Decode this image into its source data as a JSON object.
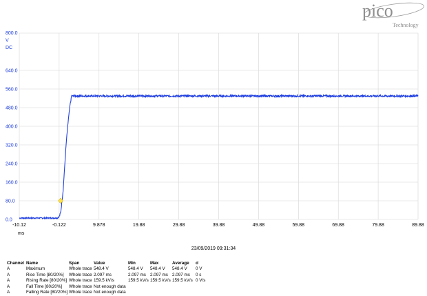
{
  "brand": {
    "name": "pico",
    "tagline": "Technology"
  },
  "timestamp": "23/09/2019 09:31:34",
  "chart_data": {
    "type": "line",
    "y_unit_lines": [
      "800.0",
      "V",
      "DC"
    ],
    "yticks": [
      640.0,
      560.0,
      480.0,
      400.0,
      320.0,
      240.0,
      160.0,
      80.0,
      0.0
    ],
    "ytick_labels": [
      "640.0",
      "560.0",
      "480.0",
      "400.0",
      "320.0",
      "240.0",
      "160.0",
      "80.0",
      "0.0"
    ],
    "ylim": [
      0,
      800
    ],
    "xticks": [
      -10.12,
      -0.122,
      9.878,
      19.88,
      29.88,
      39.88,
      49.88,
      59.88,
      69.88,
      79.88,
      89.88
    ],
    "xtick_labels": [
      "-10.12",
      "-0.122",
      "9.878",
      "19.88",
      "29.88",
      "39.88",
      "49.88",
      "59.88",
      "69.88",
      "79.88",
      "89.88"
    ],
    "xlim": [
      -10.12,
      89.88
    ],
    "x_unit": "ms",
    "grid": true,
    "color": "#1f3fe0",
    "trace": {
      "x": [
        -10.12,
        -5.0,
        -0.5,
        0.0,
        0.3,
        0.6,
        0.9,
        1.2,
        1.5,
        1.8,
        2.2,
        2.6,
        3.0,
        4.0,
        89.88
      ],
      "y": [
        6,
        6,
        6,
        15,
        35,
        80,
        130,
        210,
        290,
        360,
        430,
        490,
        530,
        530,
        530
      ],
      "noise": 8
    },
    "marker": {
      "x": 0.25,
      "y": 80,
      "color": "#ffe24a"
    }
  },
  "measurements": {
    "headers": [
      "Channel",
      "Name",
      "Span",
      "Value",
      "Min",
      "Max",
      "Average",
      "σ"
    ],
    "rows": [
      [
        "A",
        "Maximum",
        "Whole trace",
        "548.4 V",
        "548.4 V",
        "548.4 V",
        "548.4 V",
        "0 V"
      ],
      [
        "A",
        "Rise Time  [80/20%]",
        "Whole trace",
        "2.097 ms",
        "2.097 ms",
        "2.097 ms",
        "2.097 ms",
        "0 s"
      ],
      [
        "A",
        "Rising Rate  [80/20%]",
        "Whole trace",
        "159.5 kV/s",
        "159.5 kV/s",
        "159.5 kV/s",
        "159.5 kV/s",
        "0 V/s"
      ],
      [
        "A",
        "Fall Time  [80/20%]",
        "Whole trace",
        "Not enough data",
        "",
        "",
        "",
        ""
      ],
      [
        "A",
        "Falling Rate  [80/20%]",
        "Whole trace",
        "Not enough data",
        "",
        "",
        "",
        ""
      ]
    ]
  }
}
